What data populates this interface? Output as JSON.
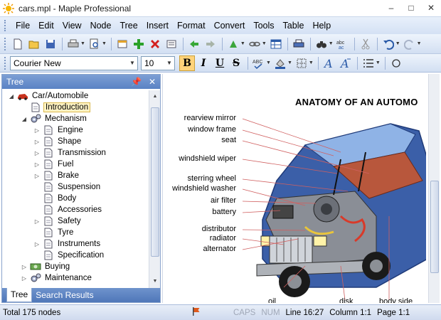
{
  "window": {
    "title": "cars.mpl - Maple Professional",
    "minimize": "–",
    "maximize": "□",
    "close": "✕"
  },
  "menu": [
    "File",
    "Edit",
    "View",
    "Node",
    "Tree",
    "Insert",
    "Format",
    "Convert",
    "Tools",
    "Table",
    "Help"
  ],
  "toolbar": {
    "font_name": "Courier New",
    "font_size": "10",
    "bold": "B",
    "italic": "I",
    "underline": "U",
    "strike": "S"
  },
  "tree_pane": {
    "header": "Tree",
    "nodes": [
      {
        "label": "Car/Automobile",
        "level": 0,
        "expander": "◢",
        "icon": "car-icon"
      },
      {
        "label": "Introduction",
        "level": 1,
        "expander": "",
        "icon": "document-icon",
        "selected": true
      },
      {
        "label": "Mechanism",
        "level": 1,
        "expander": "◢",
        "icon": "gears-icon"
      },
      {
        "label": "Engine",
        "level": 2,
        "expander": "▷",
        "icon": "document-icon"
      },
      {
        "label": "Shape",
        "level": 2,
        "expander": "▷",
        "icon": "document-icon"
      },
      {
        "label": "Transmission",
        "level": 2,
        "expander": "▷",
        "icon": "document-icon"
      },
      {
        "label": "Fuel",
        "level": 2,
        "expander": "▷",
        "icon": "document-icon"
      },
      {
        "label": "Brake",
        "level": 2,
        "expander": "▷",
        "icon": "document-icon"
      },
      {
        "label": "Suspension",
        "level": 2,
        "expander": "",
        "icon": "document-icon"
      },
      {
        "label": "Body",
        "level": 2,
        "expander": "",
        "icon": "document-icon"
      },
      {
        "label": "Accessories",
        "level": 2,
        "expander": "",
        "icon": "document-icon"
      },
      {
        "label": "Safety",
        "level": 2,
        "expander": "▷",
        "icon": "document-icon"
      },
      {
        "label": "Tyre",
        "level": 2,
        "expander": "",
        "icon": "document-icon"
      },
      {
        "label": "Instruments",
        "level": 2,
        "expander": "▷",
        "icon": "document-icon"
      },
      {
        "label": "Specification",
        "level": 2,
        "expander": "",
        "icon": "document-icon"
      },
      {
        "label": "Buying",
        "level": 1,
        "expander": "▷",
        "icon": "money-icon"
      },
      {
        "label": "Maintenance",
        "level": 1,
        "expander": "▷",
        "icon": "gears-icon"
      }
    ],
    "tabs": [
      "Tree",
      "Search Results"
    ],
    "active_tab": "Tree"
  },
  "document": {
    "title": "ANATOMY OF AN AUTOMO",
    "labels": [
      "rearview mirror",
      "window frame",
      "seat",
      "windshield wiper",
      "sterring wheel",
      "windshield washer",
      "air filter",
      "battery",
      "distributor",
      "radiator",
      "alternator"
    ],
    "bottom_labels": [
      "oil",
      "disk",
      "body side"
    ]
  },
  "status": {
    "nodes": "Total 175 nodes",
    "caps": "CAPS",
    "num": "NUM",
    "line": "Line 16:27",
    "column": "Column 1:1",
    "page": "Page 1:1"
  },
  "colors": {
    "accent": "#5a82c4",
    "selection": "#fff3c4",
    "car_body": "#3b5fa8"
  }
}
